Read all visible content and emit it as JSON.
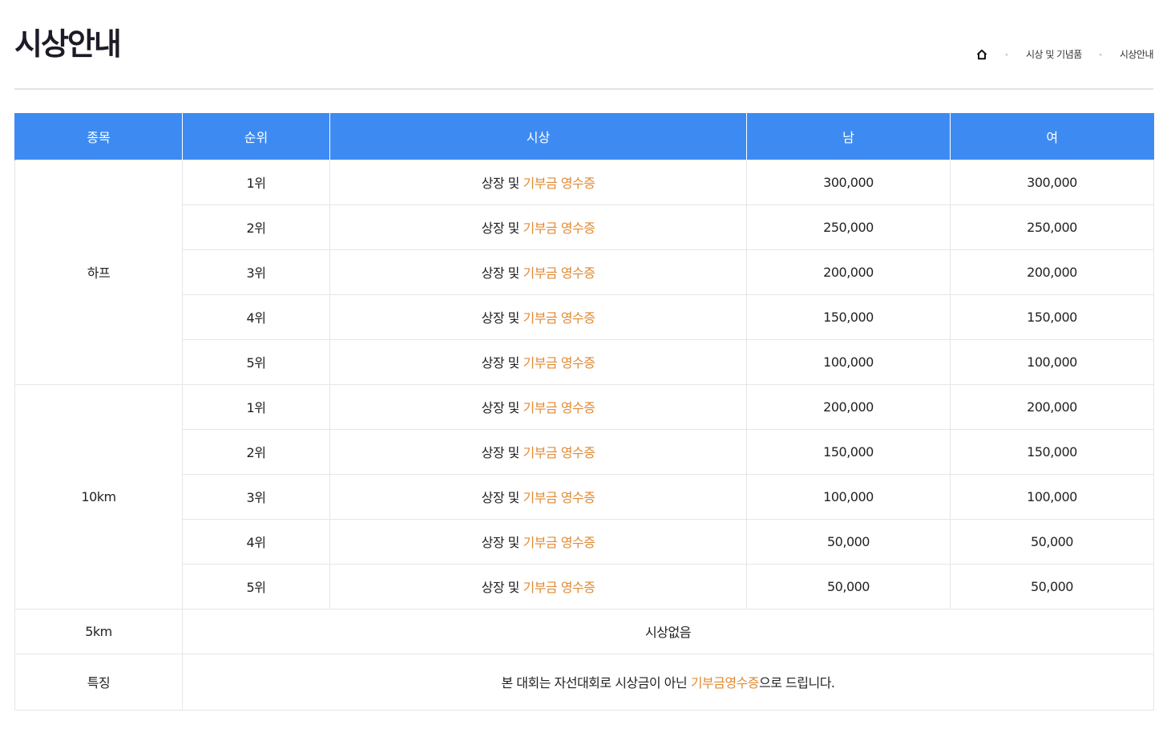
{
  "page_title": "시상안내",
  "breadcrumb": {
    "home_icon": "home-icon",
    "items": [
      "시상 및 기념품",
      "시상안내"
    ]
  },
  "colors": {
    "header_bg": "#3d8bf2",
    "highlight": "#e08a34"
  },
  "table": {
    "headers": [
      "종목",
      "순위",
      "시상",
      "남",
      "여"
    ],
    "award_text": {
      "plain": "상장 및 ",
      "highlight": "기부금 영수증"
    },
    "groups": [
      {
        "category": "하프",
        "rows": [
          {
            "rank": "1위",
            "male": "300,000",
            "female": "300,000"
          },
          {
            "rank": "2위",
            "male": "250,000",
            "female": "250,000"
          },
          {
            "rank": "3위",
            "male": "200,000",
            "female": "200,000"
          },
          {
            "rank": "4위",
            "male": "150,000",
            "female": "150,000"
          },
          {
            "rank": "5위",
            "male": "100,000",
            "female": "100,000"
          }
        ]
      },
      {
        "category": "10km",
        "rows": [
          {
            "rank": "1위",
            "male": "200,000",
            "female": "200,000"
          },
          {
            "rank": "2위",
            "male": "150,000",
            "female": "150,000"
          },
          {
            "rank": "3위",
            "male": "100,000",
            "female": "100,000"
          },
          {
            "rank": "4위",
            "male": "50,000",
            "female": "50,000"
          },
          {
            "rank": "5위",
            "male": "50,000",
            "female": "50,000"
          }
        ]
      }
    ],
    "five_km": {
      "category": "5km",
      "text": "시상없음"
    },
    "feature": {
      "category": "특징",
      "text_before": "본 대회는 자선대회로 시상금이 아닌 ",
      "text_highlight": "기부금영수증",
      "text_after": "으로 드립니다."
    }
  }
}
